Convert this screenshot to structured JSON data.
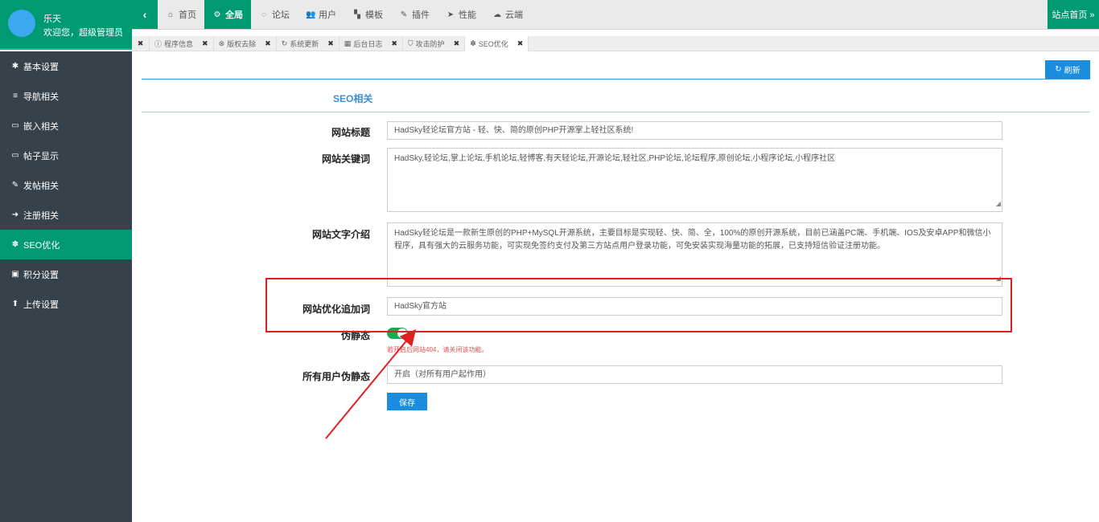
{
  "user": {
    "name": "乐天",
    "welcome": "欢迎您，超级管理员"
  },
  "topnav": {
    "items": [
      {
        "label": "首页",
        "icon": "home-icon",
        "glyph": "⌂"
      },
      {
        "label": "全局",
        "icon": "cogs-icon",
        "glyph": "⚙",
        "active": true
      },
      {
        "label": "论坛",
        "icon": "comments-icon",
        "glyph": "◌"
      },
      {
        "label": "用户",
        "icon": "users-icon",
        "glyph": "👥"
      },
      {
        "label": "模板",
        "icon": "sitemap-icon",
        "glyph": "▚"
      },
      {
        "label": "插件",
        "icon": "plug-icon",
        "glyph": "✎"
      },
      {
        "label": "性能",
        "icon": "rocket-icon",
        "glyph": "➤"
      },
      {
        "label": "云端",
        "icon": "cloud-icon",
        "glyph": "☁"
      }
    ],
    "home_link": "站点首页 »"
  },
  "tabs": [
    {
      "label": "程序信息",
      "glyph": "ⓘ"
    },
    {
      "label": "版权去除",
      "glyph": "⊗"
    },
    {
      "label": "系统更新",
      "glyph": "↻"
    },
    {
      "label": "后台日志",
      "glyph": "▦"
    },
    {
      "label": "攻击防护",
      "glyph": "⛉"
    },
    {
      "label": "SEO优化",
      "glyph": "✽",
      "active": true
    }
  ],
  "sidebar": {
    "items": [
      {
        "label": "基本设置",
        "glyph": "✱"
      },
      {
        "label": "导航相关",
        "glyph": "≡"
      },
      {
        "label": "嵌入相关",
        "glyph": "▭"
      },
      {
        "label": "帖子显示",
        "glyph": "▭"
      },
      {
        "label": "发帖相关",
        "glyph": "✎"
      },
      {
        "label": "注册相关",
        "glyph": "➜"
      },
      {
        "label": "SEO优化",
        "glyph": "✽",
        "active": true
      },
      {
        "label": "积分设置",
        "glyph": "▣"
      },
      {
        "label": "上传设置",
        "glyph": "⬆"
      }
    ]
  },
  "refresh_label": "刷新",
  "section_title": "SEO相关",
  "form": {
    "title_label": "网站标题",
    "title_value": "HadSky轻论坛官方站 - 轻、快、简的原创PHP开源掌上轻社区系统!",
    "keywords_label": "网站关键词",
    "keywords_value": "HadSky,轻论坛,掌上论坛,手机论坛,轻博客,有天轻论坛,开源论坛,轻社区,PHP论坛,论坛程序,原创论坛,小程序论坛,小程序社区",
    "intro_label": "网站文字介绍",
    "intro_value": "HadSky轻论坛是一款新生原创的PHP+MySQL开源系统，主要目标是实现轻、快、简、全，100%的原创开源系统，目前已涵盖PC端、手机端、IOS及安卓APP和微信小程序，具有强大的云服务功能，可实现免签约支付及第三方站点用户登录功能，可免安装实现海量功能的拓展，已支持短信验证注册功能。",
    "suffix_label": "网站优化追加词",
    "suffix_value": "HadSky官方站",
    "rewrite_label": "伪静态",
    "rewrite_on": true,
    "rewrite_hint": "若开启后网站404，请关闭该功能。",
    "all_rewrite_label": "所有用户伪静态",
    "all_rewrite_value": "开启（对所有用户起作用）",
    "save_label": "保存"
  }
}
